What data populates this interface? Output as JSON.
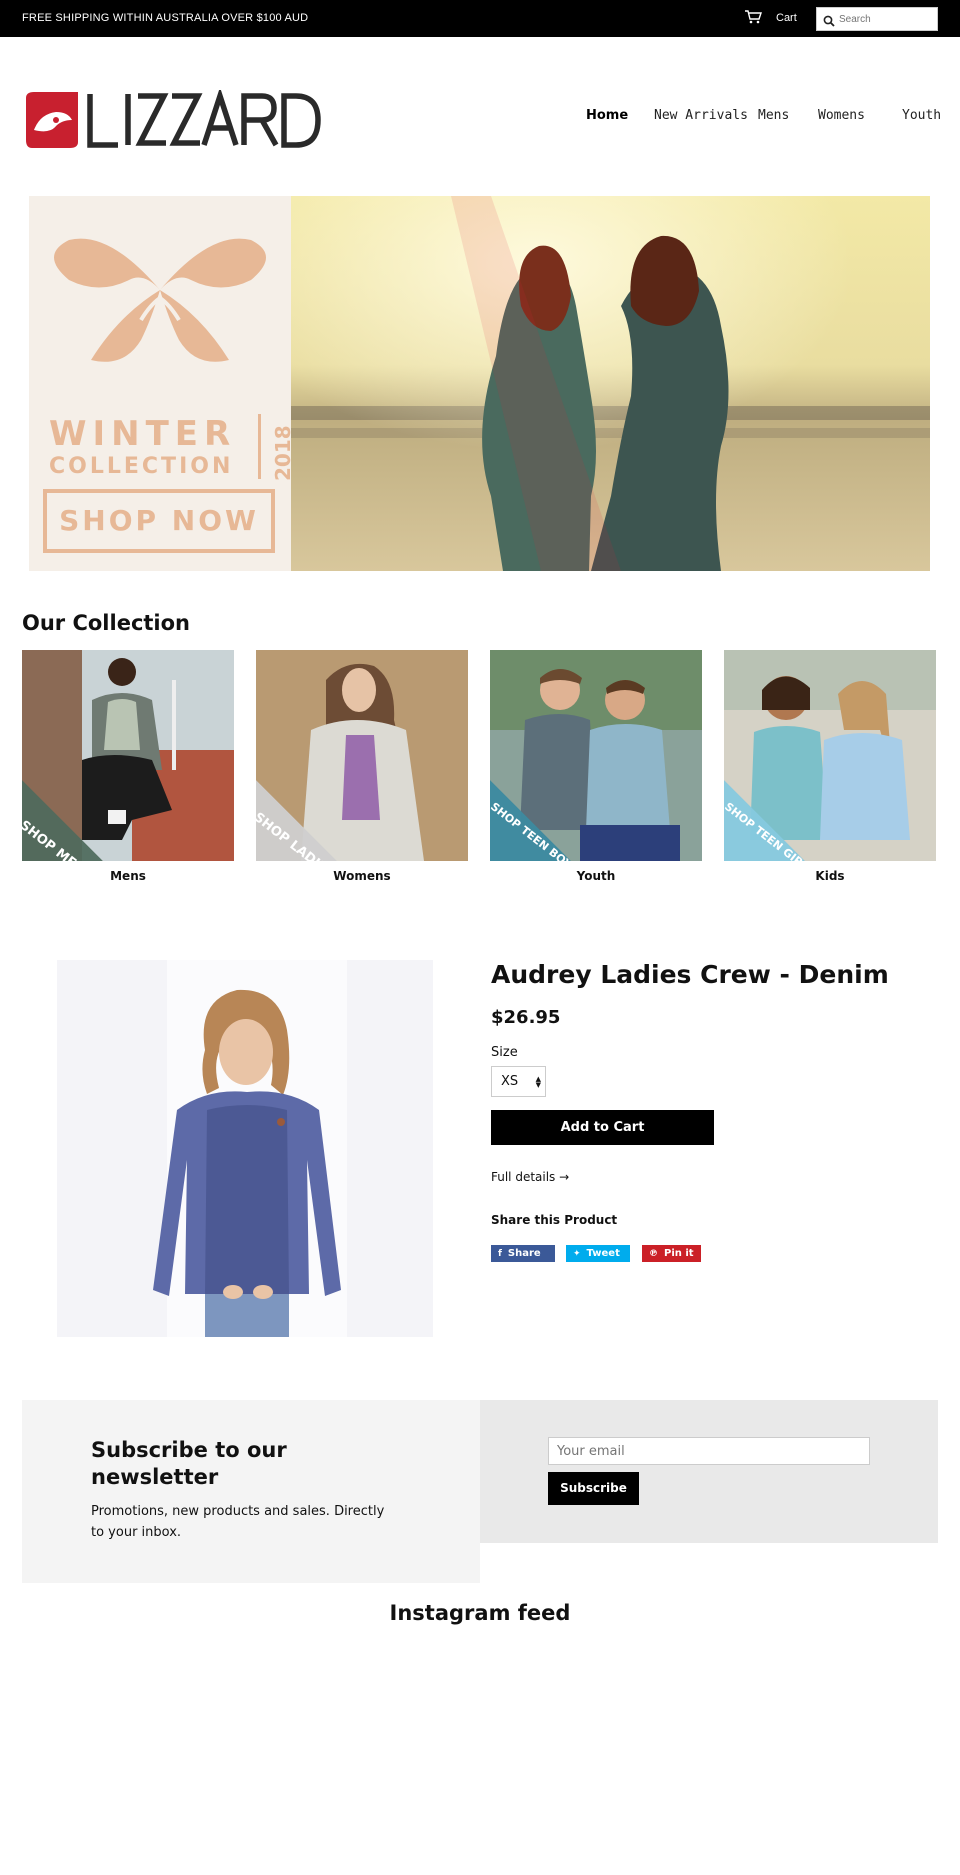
{
  "topbar": {
    "shipping_text": "FREE SHIPPING WITHIN AUSTRALIA OVER $100 AUD",
    "cart_label": "Cart",
    "search_placeholder": "Search"
  },
  "header": {
    "logo_text": "LIZZARD",
    "nav": [
      {
        "label": "Home"
      },
      {
        "label": "New Arrivals"
      },
      {
        "label": "Mens"
      },
      {
        "label": "Womens"
      },
      {
        "label": "Youth"
      }
    ]
  },
  "hero": {
    "winter": "WINTER",
    "collection": "COLLECTION",
    "year": "2018",
    "cta": "SHOP NOW",
    "slide_count": 4,
    "active_slide": 2
  },
  "collection": {
    "title": "Our Collection",
    "cards": [
      {
        "label": "Mens",
        "ribbon": "SHOP MENS",
        "ribbon_color": "#4f6b5c"
      },
      {
        "label": "Womens",
        "ribbon": "SHOP LADIES",
        "ribbon_color": "#cfcfcf"
      },
      {
        "label": "Youth",
        "ribbon": "SHOP TEEN BOYS",
        "ribbon_color": "#3c8aa0"
      },
      {
        "label": "Kids",
        "ribbon": "SHOP TEEN GIRLS",
        "ribbon_color": "#86c9df"
      }
    ]
  },
  "product": {
    "title": "Audrey Ladies Crew - Denim",
    "price": "$26.95",
    "size_label": "Size",
    "size_value": "XS",
    "add_to_cart": "Add to Cart",
    "full_details": "Full details →",
    "share_label": "Share this Product",
    "share_buttons": [
      {
        "label": "Share",
        "icon": "facebook-icon",
        "color": "#3b5998"
      },
      {
        "label": "Tweet",
        "icon": "twitter-icon",
        "color": "#00aced"
      },
      {
        "label": "Pin it",
        "icon": "pinterest-icon",
        "color": "#cb2027"
      }
    ]
  },
  "newsletter": {
    "title": "Subscribe to our newsletter",
    "text": "Promotions, new products and sales. Directly to your inbox.",
    "email_placeholder": "Your email",
    "button": "Subscribe"
  },
  "instagram": {
    "title": "Instagram feed"
  },
  "colors": {
    "brand_red": "#c8202f",
    "promo_peach": "#e7b896"
  }
}
